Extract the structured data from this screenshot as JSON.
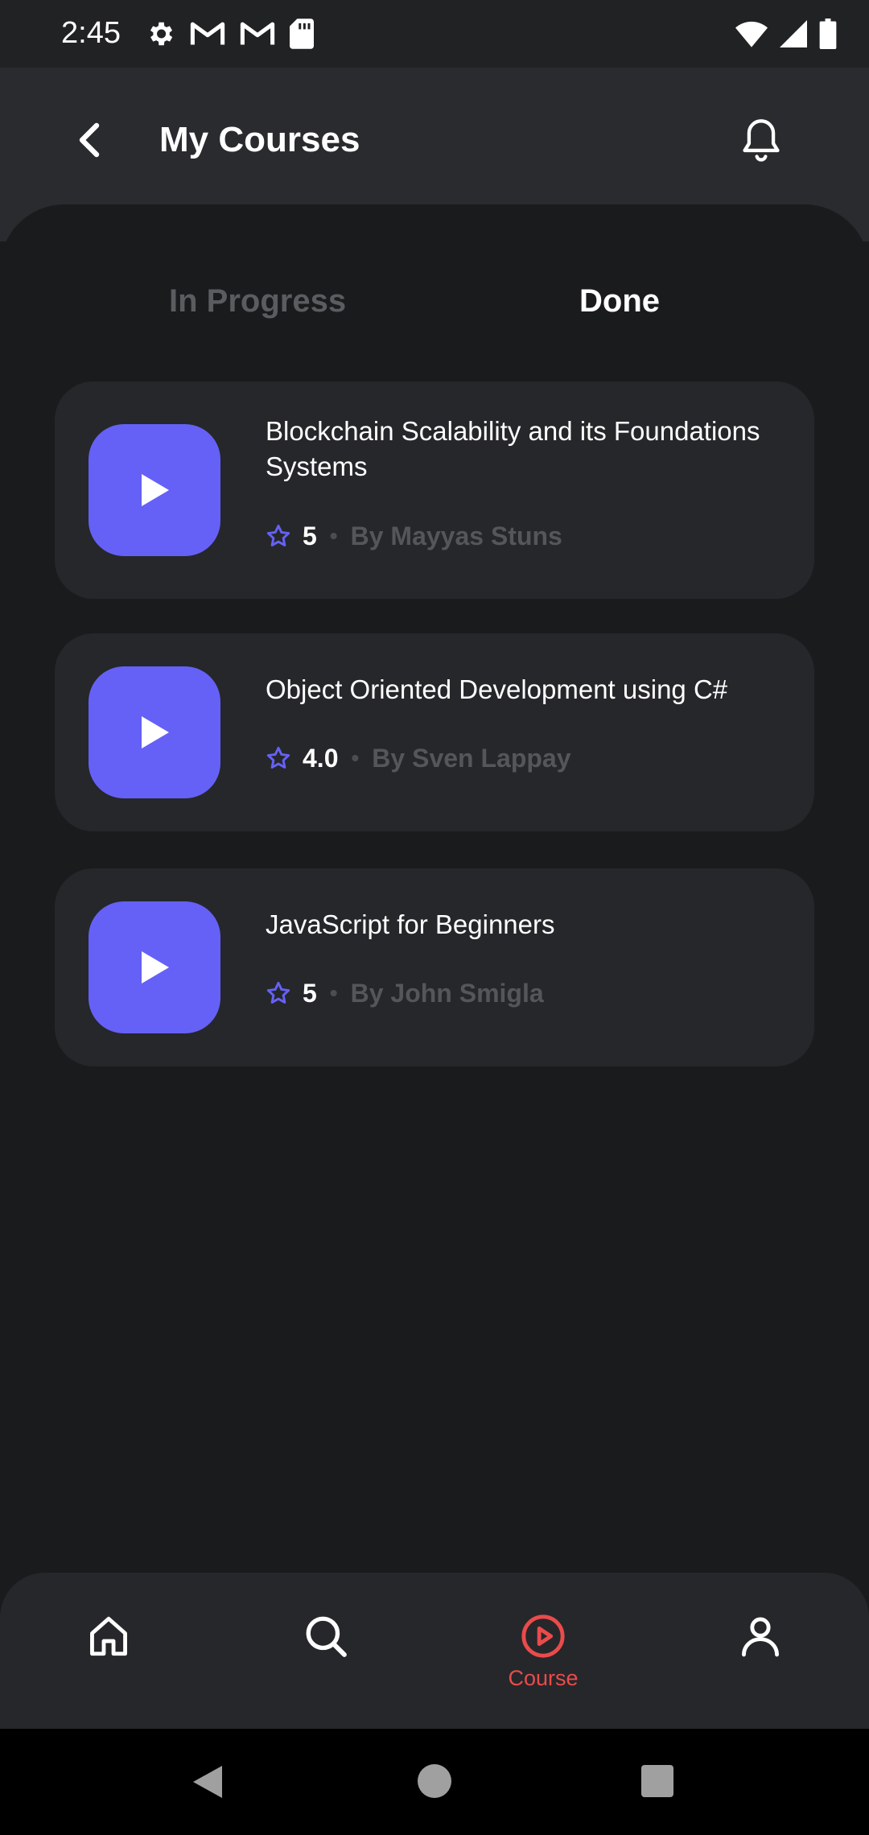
{
  "status_bar": {
    "time": "2:45",
    "left_icons": [
      "settings-icon",
      "gmail-icon",
      "gmail-icon",
      "sd-card-icon"
    ],
    "right_icons": [
      "wifi-icon",
      "signal-icon",
      "battery-icon"
    ]
  },
  "header": {
    "back_icon": "chevron-left-icon",
    "title": "My Courses",
    "notification_icon": "bell-icon"
  },
  "tabs": [
    {
      "label": "In Progress",
      "active": false
    },
    {
      "label": "Done",
      "active": true
    }
  ],
  "courses": [
    {
      "title": "Blockchain Scalability and its Foundations Systems",
      "rating": "5",
      "author": "By Mayyas Stuns"
    },
    {
      "title": "Object Oriented Development using C#",
      "rating": "4.0",
      "author": "By Sven Lappay"
    },
    {
      "title": "JavaScript for Beginners",
      "rating": "5",
      "author": "By John Smigla"
    }
  ],
  "meta_separator": "•",
  "bottom_nav": [
    {
      "icon": "home-icon",
      "label": "",
      "active": false
    },
    {
      "icon": "search-icon",
      "label": "",
      "active": false
    },
    {
      "icon": "play-circle-icon",
      "label": "Course",
      "active": true
    },
    {
      "icon": "user-icon",
      "label": "",
      "active": false
    }
  ],
  "colors": {
    "accent": "#6561f6",
    "active_nav": "#ea4b4b",
    "background": "#1a1b1d",
    "card": "#26272a",
    "header": "#2a2b2e"
  }
}
